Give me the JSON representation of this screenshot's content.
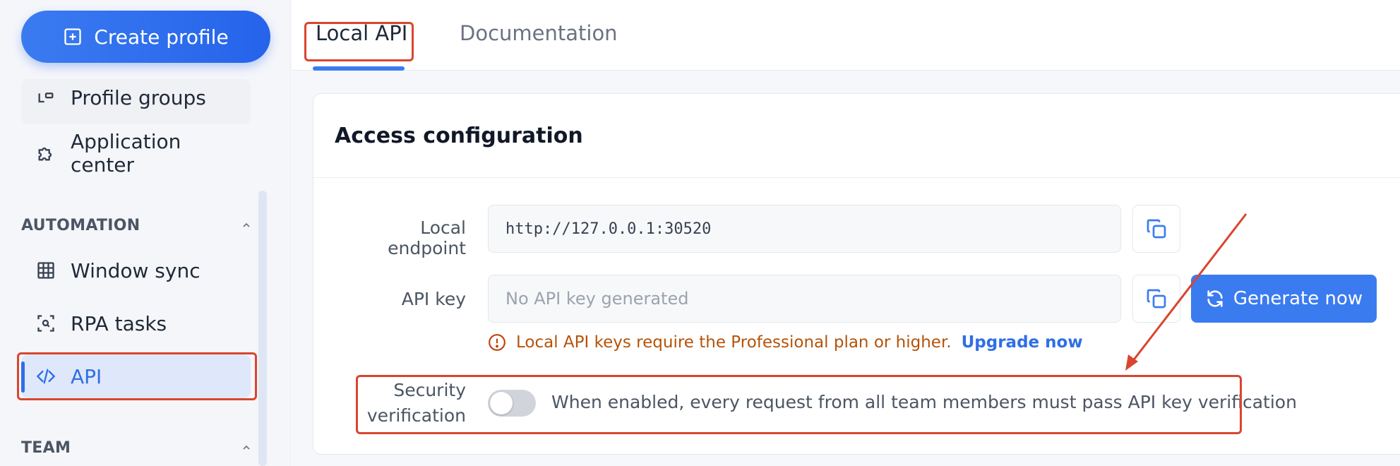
{
  "sidebar": {
    "create_button": "Create profile",
    "items_top": [
      {
        "label": "Profile groups",
        "icon": "profile-groups-icon"
      },
      {
        "label": "Application center",
        "icon": "puzzle-icon"
      }
    ],
    "automation_section": "AUTOMATION",
    "automation_items": [
      {
        "label": "Window sync",
        "icon": "grid-icon"
      },
      {
        "label": "RPA tasks",
        "icon": "scan-icon"
      },
      {
        "label": "API",
        "icon": "code-icon",
        "active": true
      }
    ],
    "team_section": "TEAM"
  },
  "tabs": {
    "local_api": "Local API",
    "documentation": "Documentation",
    "active": "Local API"
  },
  "card": {
    "title": "Access configuration",
    "endpoint_label": "Local endpoint",
    "endpoint_value": "http://127.0.0.1:30520",
    "api_key_label": "API key",
    "api_key_placeholder": "No API key generated",
    "generate_button": "Generate now",
    "warning_text": "Local API keys require the Professional plan or higher.",
    "upgrade_link": "Upgrade now",
    "security_label_line1": "Security",
    "security_label_line2": "verification",
    "security_enabled": false,
    "security_description": "When enabled, every request from all team members must pass API key verification"
  },
  "colors": {
    "accent": "#3b7bf0",
    "highlight": "#d9452e",
    "warning": "#b45309"
  }
}
